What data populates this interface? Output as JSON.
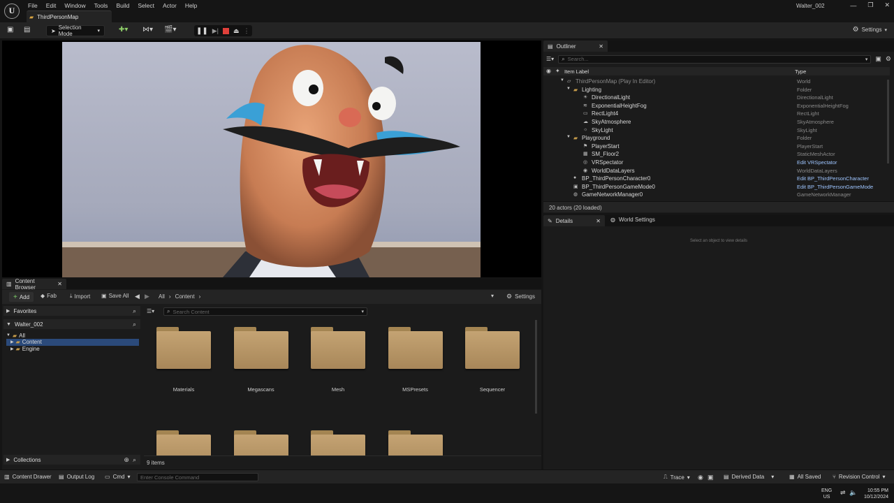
{
  "app": {
    "logo": "U",
    "menu": [
      "File",
      "Edit",
      "Window",
      "Tools",
      "Build",
      "Select",
      "Actor",
      "Help"
    ],
    "document_tab": "ThirdPersonMap",
    "project_name": "Walter_002",
    "window_controls": [
      "—",
      "❐",
      "✕"
    ]
  },
  "toolbar": {
    "mode": "Selection Mode",
    "settings": "Settings"
  },
  "outliner": {
    "tab": "Outliner",
    "search_placeholder": "Search...",
    "col_label": "Item Label",
    "col_type": "Type",
    "rows": [
      {
        "label": "ThirdPersonMap (Play In Editor)",
        "type": "World",
        "indent": 0,
        "icon": "map",
        "link": false,
        "dim": true
      },
      {
        "label": "Lighting",
        "type": "Folder",
        "indent": 1,
        "icon": "folder",
        "link": false
      },
      {
        "label": "DirectionalLight",
        "type": "DirectionalLight",
        "indent": 2,
        "icon": "light",
        "link": false
      },
      {
        "label": "ExponentialHeightFog",
        "type": "ExponentialHeightFog",
        "indent": 2,
        "icon": "fog",
        "link": false
      },
      {
        "label": "RectLight4",
        "type": "RectLight",
        "indent": 2,
        "icon": "rect",
        "link": false
      },
      {
        "label": "SkyAtmosphere",
        "type": "SkyAtmosphere",
        "indent": 2,
        "icon": "sky",
        "link": false
      },
      {
        "label": "SkyLight",
        "type": "SkyLight",
        "indent": 2,
        "icon": "skylight",
        "link": false
      },
      {
        "label": "Playground",
        "type": "Folder",
        "indent": 1,
        "icon": "folder",
        "link": false
      },
      {
        "label": "PlayerStart",
        "type": "PlayerStart",
        "indent": 2,
        "icon": "player",
        "link": false
      },
      {
        "label": "SM_Floor2",
        "type": "StaticMeshActor",
        "indent": 2,
        "icon": "mesh",
        "link": false
      },
      {
        "label": "VRSpectator",
        "type": "Edit VRSpectator",
        "indent": 2,
        "icon": "vr",
        "link": true
      },
      {
        "label": "WorldDataLayers",
        "type": "WorldDataLayers",
        "indent": 2,
        "icon": "layers",
        "link": false
      },
      {
        "label": "BP_ThirdPersonCharacter0",
        "type": "Edit BP_ThirdPersonCharacter",
        "indent": 1,
        "icon": "char",
        "link": true
      },
      {
        "label": "BP_ThirdPersonGameMode0",
        "type": "Edit BP_ThirdPersonGameMode",
        "indent": 1,
        "icon": "gamemode",
        "link": true
      },
      {
        "label": "GameNetworkManager0",
        "type": "GameNetworkManager",
        "indent": 1,
        "icon": "net",
        "link": false
      }
    ],
    "footer": "20 actors (20 loaded)"
  },
  "details": {
    "tab": "Details",
    "tab2": "World Settings",
    "empty_hint": "Select an object to view details"
  },
  "content_browser": {
    "tab": "Content Browser",
    "add": "Add",
    "fab": "Fab",
    "import": "Import",
    "save_all": "Save All",
    "path": [
      "All",
      "Content"
    ],
    "settings": "Settings",
    "favorites": "Favorites",
    "project": "Walter_002",
    "tree": [
      {
        "label": "All",
        "indent": 0,
        "selected": false
      },
      {
        "label": "Content",
        "indent": 1,
        "selected": true
      },
      {
        "label": "Engine",
        "indent": 1,
        "selected": false
      }
    ],
    "search_placeholder": "Search Content",
    "folders": [
      "Materials",
      "Megascans",
      "Mesh",
      "MSPresets",
      "Sequencer",
      "",
      "",
      "",
      ""
    ],
    "collections": "Collections",
    "item_count": "9 items"
  },
  "statusbar": {
    "content_drawer": "Content Drawer",
    "output_log": "Output Log",
    "cmd": "Cmd",
    "console_placeholder": "Enter Console Command",
    "trace": "Trace",
    "derived_data": "Derived Data",
    "all_saved": "All Saved",
    "revision_control": "Revision Control"
  },
  "taskbar": {
    "lang": "ENG",
    "region": "US",
    "time": "10:55 PM",
    "date": "10/12/2024"
  },
  "colors": {
    "accent": "#2f6fd6",
    "selection": "#2b4a7a",
    "folder": "#c4a373",
    "link": "#9ec5ff",
    "stop": "#e0403a"
  }
}
